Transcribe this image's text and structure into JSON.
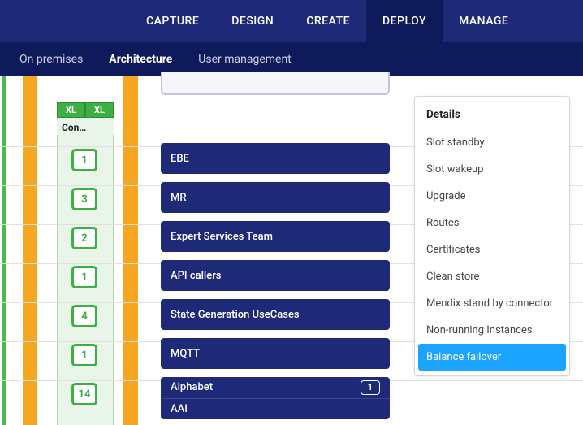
{
  "topnav": {
    "items": [
      {
        "label": "CAPTURE"
      },
      {
        "label": "DESIGN"
      },
      {
        "label": "CREATE"
      },
      {
        "label": "DEPLOY",
        "active": true
      },
      {
        "label": "MANAGE"
      }
    ]
  },
  "subnav": {
    "items": [
      {
        "label": "On premises"
      },
      {
        "label": "Architecture",
        "active": true
      },
      {
        "label": "User management"
      }
    ]
  },
  "column": {
    "size_label_left": "XL",
    "size_label_right": "XL",
    "title": "Con…"
  },
  "rows": [
    {
      "count": "1",
      "label": "EBE"
    },
    {
      "count": "3",
      "label": "MR",
      "stacked": true
    },
    {
      "count": "2",
      "label": "Expert Services Team"
    },
    {
      "count": "1",
      "label": "API callers"
    },
    {
      "count": "4",
      "label": "State Generation UseCases"
    },
    {
      "count": "1",
      "label": "MQTT"
    },
    {
      "count": "14",
      "label": "Alphabet",
      "sub_label": "AAI",
      "mini": "1"
    }
  ],
  "menu": {
    "title": "Details",
    "items": [
      {
        "label": "Slot standby"
      },
      {
        "label": "Slot wakeup"
      },
      {
        "label": "Upgrade"
      },
      {
        "label": "Routes"
      },
      {
        "label": "Certificates"
      },
      {
        "label": "Clean store"
      },
      {
        "label": "Mendix stand by connector"
      },
      {
        "label": "Non-running Instances"
      },
      {
        "label": "Balance failover",
        "active": true
      }
    ]
  }
}
